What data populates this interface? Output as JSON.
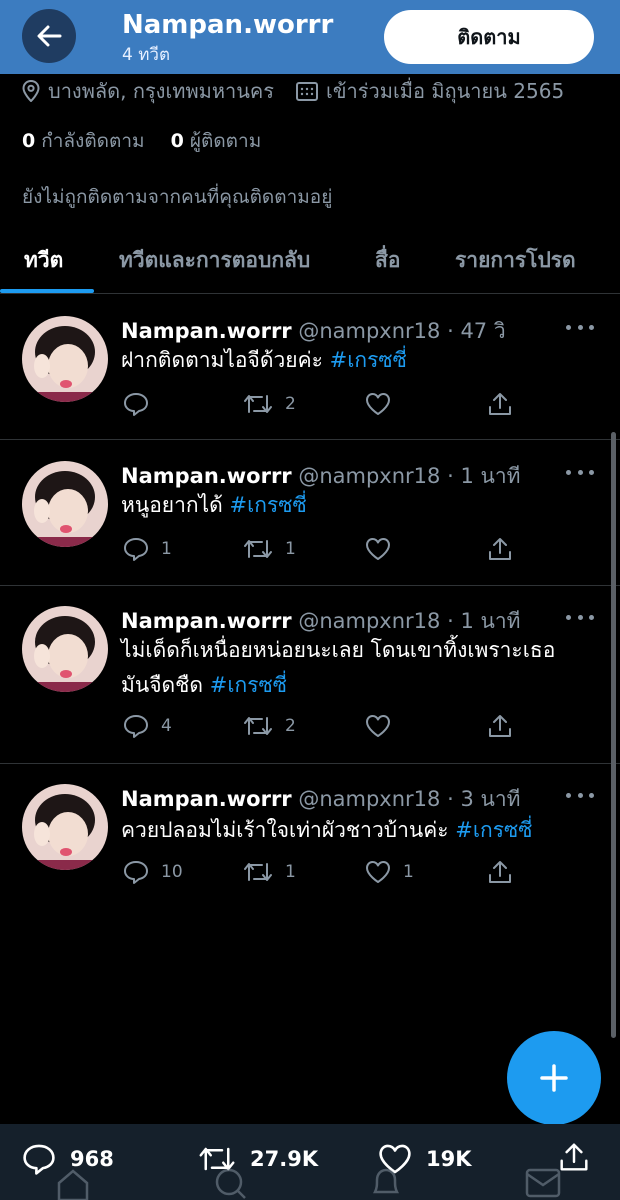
{
  "header": {
    "name": "Nampan.worrr",
    "tweet_count": "4 ทวีต",
    "follow_label": "ติดตาม"
  },
  "profile": {
    "location": "บางพลัด, กรุงเทพมหานคร",
    "joined": "เข้าร่วมเมื่อ มิถุนายน 2565",
    "following_count": "0",
    "following_label": "กำลังติดตาม",
    "followers_count": "0",
    "followers_label": "ผู้ติดตาม",
    "not_followed_text": "ยังไม่ถูกติดตามจากคนที่คุณติดตามอยู่"
  },
  "tabs": [
    {
      "label": "ทวีต",
      "active": true
    },
    {
      "label": "ทวีตและการตอบกลับ",
      "active": false
    },
    {
      "label": "สื่อ",
      "active": false
    },
    {
      "label": "รายการโปรด",
      "active": false
    }
  ],
  "tweets": [
    {
      "name": "Nampan.worrr",
      "handle": "@nampxnr18",
      "time": "· 47 วิ",
      "text": "ฝากติดตามไอจีด้วยค่ะ",
      "hashtag": "#เกรซซี่",
      "replies": "",
      "retweets": "2",
      "likes": ""
    },
    {
      "name": "Nampan.worrr",
      "handle": "@nampxnr18",
      "time": "· 1 นาที",
      "text": "หนูอยากได้",
      "hashtag": "#เกรซซี่",
      "replies": "1",
      "retweets": "1",
      "likes": ""
    },
    {
      "name": "Nampan.worrr",
      "handle": "@nampxnr18",
      "time": "· 1 นาที",
      "text": "ไม่เด็ดก็เหนื่อยหน่อยนะเลย โดนเขาทิ้งเพราะเธอมันจืดชืด",
      "hashtag": "#เกรซซี่",
      "replies": "4",
      "retweets": "2",
      "likes": ""
    },
    {
      "name": "Nampan.worrr",
      "handle": "@nampxnr18",
      "time": "· 3 นาที",
      "text": "ควยปลอมไม่เร้าใจเท่าผัวชาวบ้านค่ะ",
      "hashtag": "#เกรซซี่",
      "replies": "10",
      "retweets": "1",
      "likes": "1"
    }
  ],
  "bottom_bar": {
    "replies": "968",
    "retweets": "27.9K",
    "likes": "19K"
  },
  "colors": {
    "header_bg": "#3c7cc0",
    "accent": "#1d9bf0",
    "bottom_bar_bg": "#15202b"
  },
  "icons": [
    "back-arrow-icon",
    "location-pin-icon",
    "calendar-icon",
    "reply-icon",
    "retweet-icon",
    "like-icon",
    "share-icon",
    "more-icon",
    "plus-icon",
    "home-icon",
    "search-icon",
    "bell-icon",
    "mail-icon"
  ]
}
